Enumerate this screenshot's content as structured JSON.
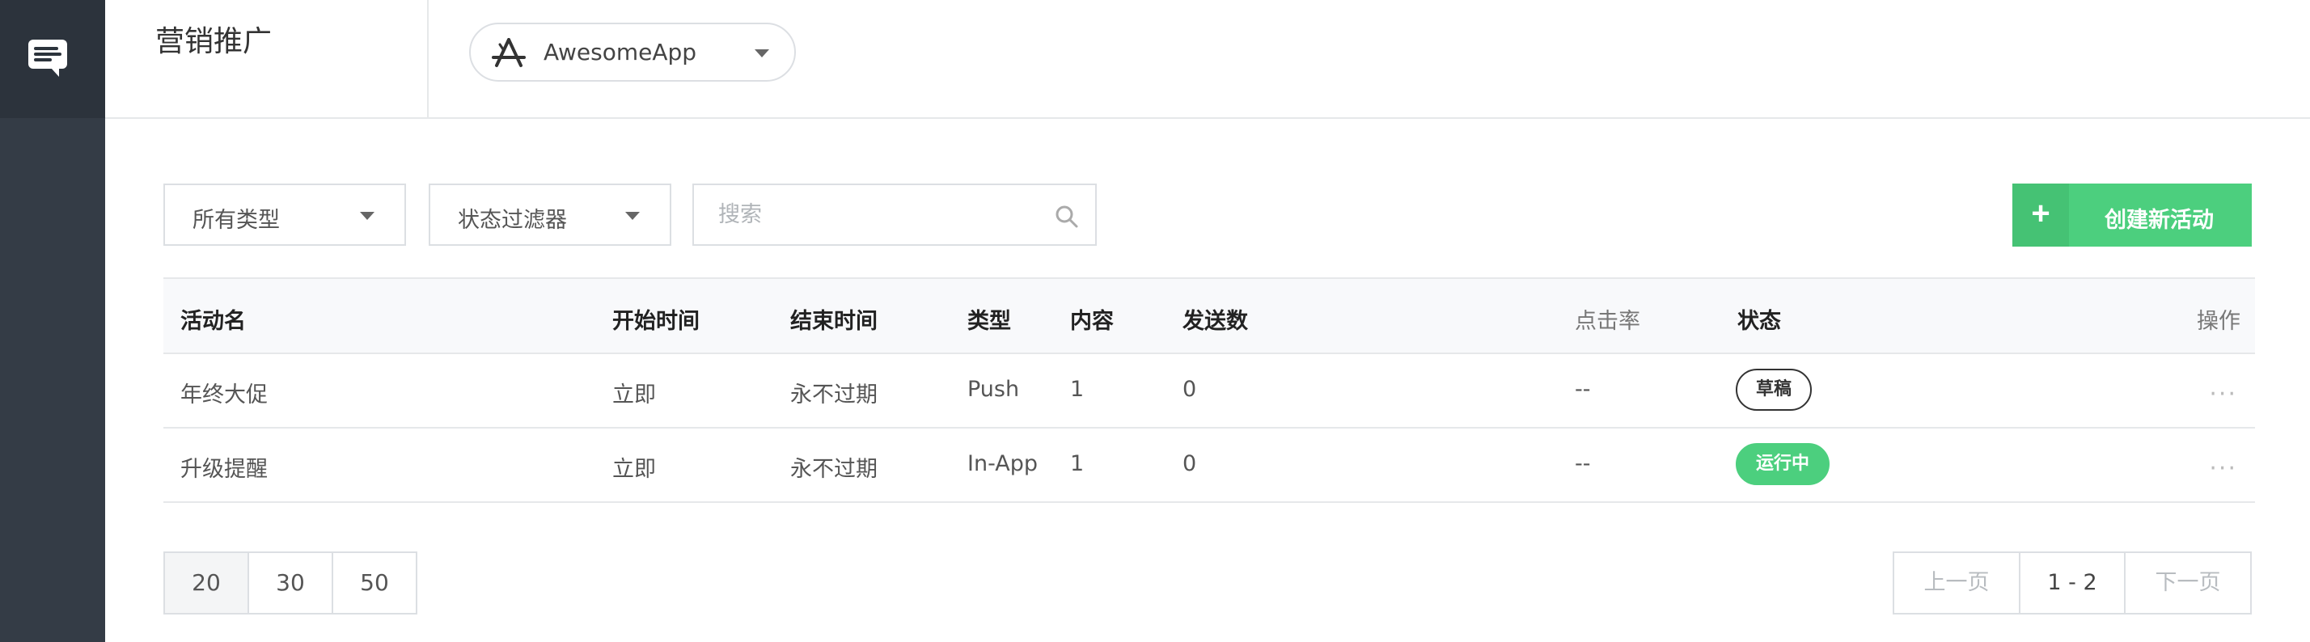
{
  "header": {
    "title": "营销推广",
    "app_selector": {
      "icon": "app-store-icon",
      "value": "AwesomeApp"
    }
  },
  "filters": {
    "type": {
      "value": "所有类型"
    },
    "status": {
      "value": "状态过滤器"
    },
    "search": {
      "placeholder": "搜索",
      "value": ""
    }
  },
  "create_button": {
    "label": "创建新活动"
  },
  "table": {
    "columns": {
      "name": "活动名",
      "start": "开始时间",
      "end": "结束时间",
      "type": "类型",
      "content": "内容",
      "sent": "发送数",
      "ctr": "点击率",
      "status": "状态",
      "action": "操作"
    },
    "rows": [
      {
        "name": "年终大促",
        "start": "立即",
        "end": "永不过期",
        "type": "Push",
        "content": "1",
        "sent": "0",
        "ctr": "--",
        "status": "草稿",
        "action": "···"
      },
      {
        "name": "升级提醒",
        "start": "立即",
        "end": "永不过期",
        "type": "In-App",
        "content": "1",
        "sent": "0",
        "ctr": "--",
        "status": "运行中",
        "action": "···"
      }
    ]
  },
  "page_size_options": [
    "20",
    "30",
    "50"
  ],
  "pagination": {
    "prev": "上一页",
    "range": "1 - 2",
    "next": "下一页"
  },
  "colors": {
    "sidebar": "#343c46",
    "accent_green": "#4ccf7e"
  }
}
